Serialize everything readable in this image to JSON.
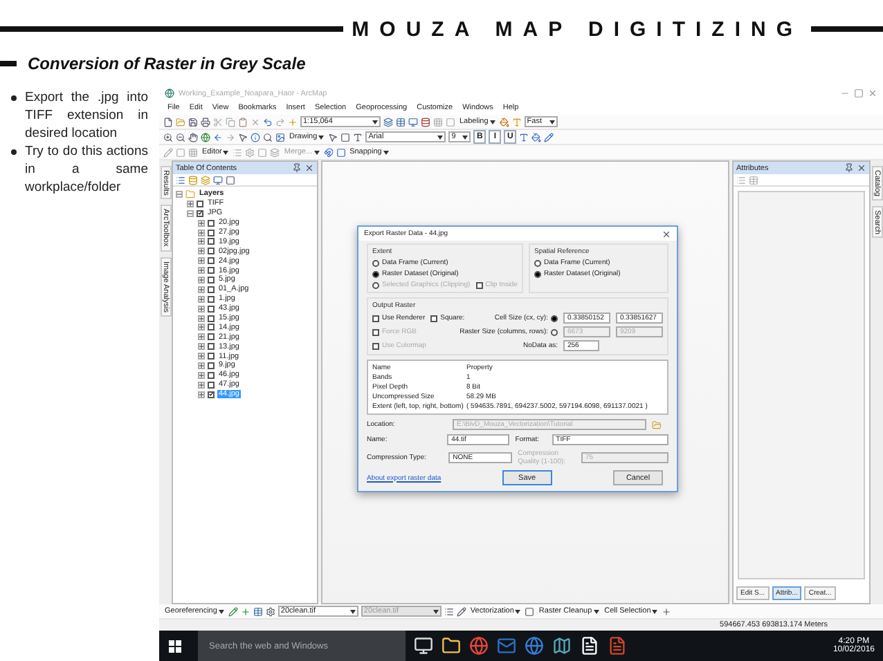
{
  "slide": {
    "title": "MOUZA MAP DIGITIZING",
    "subtitle": "Conversion of Raster in Grey Scale",
    "bullets": [
      "Export the .jpg into TIFF extension in desired location",
      "Try to do this actions in a same workplace/folder"
    ]
  },
  "app": {
    "title": "Working_Example_Noapara_Haor - ArcMap",
    "menu": [
      "File",
      "Edit",
      "View",
      "Bookmarks",
      "Insert",
      "Selection",
      "Geoprocessing",
      "Customize",
      "Windows",
      "Help"
    ],
    "toolbars": [
      {
        "items": [
          {
            "kind": "field",
            "value": "1:15,064",
            "disabled": false
          },
          {
            "kind": "menu",
            "label": "Labeling",
            "disabled": false
          },
          {
            "kind": "field",
            "value": "Fast",
            "disabled": false
          }
        ]
      },
      {
        "items": [
          {
            "kind": "menu",
            "label": "Drawing",
            "disabled": false
          },
          {
            "kind": "field",
            "value": "Arial",
            "disabled": false
          },
          {
            "kind": "field",
            "value": "9",
            "disabled": false
          },
          {
            "kind": "text_button",
            "label": "B"
          },
          {
            "kind": "text_button",
            "label": "I"
          },
          {
            "kind": "text_button",
            "label": "U"
          }
        ]
      },
      {
        "items": [
          {
            "kind": "menu",
            "label": "Editor",
            "disabled": false
          },
          {
            "kind": "menu",
            "label": "Merge...",
            "disabled": true
          },
          {
            "kind": "menu",
            "label": "Snapping",
            "disabled": false
          }
        ]
      }
    ],
    "left_tabs": [
      "Results",
      "ArcToolbox",
      "Image Analysis"
    ],
    "right_tabs": [
      "Catalog",
      "Search"
    ],
    "toc": {
      "title": "Table Of Contents",
      "tree": [
        {
          "kind": "frame",
          "label": "Layers",
          "expanded": true,
          "selected": false,
          "children": [
            {
              "kind": "layer",
              "label": "TIFF",
              "expanded": false,
              "checked": false,
              "selected": false
            },
            {
              "kind": "layer",
              "label": "JPG",
              "expanded": true,
              "checked": true,
              "selected": false,
              "children": [
                {
                  "kind": "layer",
                  "label": "20.jpg",
                  "expanded": false,
                  "checked": false,
                  "selected": false
                },
                {
                  "kind": "layer",
                  "label": "27.jpg",
                  "expanded": false,
                  "checked": false,
                  "selected": false
                },
                {
                  "kind": "layer",
                  "label": "19.jpg",
                  "expanded": false,
                  "checked": false,
                  "selected": false
                },
                {
                  "kind": "layer",
                  "label": "02jpg.jpg",
                  "expanded": false,
                  "checked": false,
                  "selected": false
                },
                {
                  "kind": "layer",
                  "label": "24.jpg",
                  "expanded": false,
                  "checked": false,
                  "selected": false
                },
                {
                  "kind": "layer",
                  "label": "16.jpg",
                  "expanded": false,
                  "checked": false,
                  "selected": false
                },
                {
                  "kind": "layer",
                  "label": "5.jpg",
                  "expanded": false,
                  "checked": false,
                  "selected": false
                },
                {
                  "kind": "layer",
                  "label": "01_A.jpg",
                  "expanded": false,
                  "checked": false,
                  "selected": false
                },
                {
                  "kind": "layer",
                  "label": "1.jpg",
                  "expanded": false,
                  "checked": false,
                  "selected": false
                },
                {
                  "kind": "layer",
                  "label": "43.jpg",
                  "expanded": false,
                  "checked": false,
                  "selected": false
                },
                {
                  "kind": "layer",
                  "label": "15.jpg",
                  "expanded": false,
                  "checked": false,
                  "selected": false
                },
                {
                  "kind": "layer",
                  "label": "14.jpg",
                  "expanded": false,
                  "checked": false,
                  "selected": false
                },
                {
                  "kind": "layer",
                  "label": "21.jpg",
                  "expanded": false,
                  "checked": false,
                  "selected": false
                },
                {
                  "kind": "layer",
                  "label": "13.jpg",
                  "expanded": false,
                  "checked": false,
                  "selected": false
                },
                {
                  "kind": "layer",
                  "label": "11.jpg",
                  "expanded": false,
                  "checked": false,
                  "selected": false
                },
                {
                  "kind": "layer",
                  "label": "9.jpg",
                  "expanded": false,
                  "checked": false,
                  "selected": false
                },
                {
                  "kind": "layer",
                  "label": "46.jpg",
                  "expanded": false,
                  "checked": false,
                  "selected": false
                },
                {
                  "kind": "layer",
                  "label": "47.jpg",
                  "expanded": false,
                  "checked": false,
                  "selected": false
                },
                {
                  "kind": "layer",
                  "label": "44.jpg",
                  "expanded": false,
                  "checked": true,
                  "selected": true
                }
              ]
            }
          ]
        }
      ]
    },
    "attributes": {
      "title": "Attributes",
      "tabs": [
        {
          "label": "Edit S...",
          "selected": false
        },
        {
          "label": "Attrib...",
          "selected": true
        },
        {
          "label": "Creat...",
          "selected": false
        }
      ]
    },
    "bottom_toolbar": {
      "items": [
        {
          "kind": "menu",
          "label": "Georeferencing",
          "disabled": false
        },
        {
          "kind": "field",
          "value": "20clean.tif",
          "disabled": false
        },
        {
          "kind": "field",
          "value": "20clean.tif",
          "disabled": true
        },
        {
          "kind": "menu",
          "label": "Vectorization",
          "disabled": false
        },
        {
          "kind": "menu",
          "label": "Raster Cleanup",
          "disabled": false
        },
        {
          "kind": "menu",
          "label": "Cell Selection",
          "disabled": false
        }
      ]
    },
    "status": "594667.453  693813.174 Meters"
  },
  "dialog": {
    "title": "Export Raster Data - 44.jpg",
    "extent": {
      "label": "Extent",
      "options": [
        {
          "label": "Data Frame (Current)",
          "selected": false,
          "disabled": false
        },
        {
          "label": "Raster Dataset (Original)",
          "selected": true,
          "disabled": false
        },
        {
          "label": "Selected Graphics (Clipping)",
          "selected": false,
          "disabled": true
        }
      ],
      "clip_inside": {
        "label": "Clip Inside",
        "checked": false,
        "disabled": true
      }
    },
    "spatial_reference": {
      "label": "Spatial Reference",
      "options": [
        {
          "label": "Data Frame (Current)",
          "selected": false,
          "disabled": false
        },
        {
          "label": "Raster Dataset (Original)",
          "selected": true,
          "disabled": false
        }
      ]
    },
    "output_raster": {
      "label": "Output Raster",
      "use_renderer": {
        "label": "Use Renderer",
        "checked": false,
        "disabled": false
      },
      "square": {
        "label": "Square:",
        "checked": false,
        "disabled": false
      },
      "force_rgb": {
        "label": "Force RGB",
        "checked": false,
        "disabled": true
      },
      "use_colormap": {
        "label": "Use Colormap",
        "checked": false,
        "disabled": true
      },
      "cell_size": {
        "label": "Cell Size (cx, cy):",
        "selected": true,
        "values": [
          "0.33850152",
          "0.33851627"
        ]
      },
      "raster_size": {
        "label": "Raster Size (columns, rows):",
        "selected": false,
        "values": [
          "6673",
          "9209"
        ]
      },
      "nodata": {
        "label": "NoData as:",
        "value": "256"
      }
    },
    "properties": {
      "columns": [
        "Name",
        "Property"
      ],
      "rows": [
        [
          "Bands",
          "1"
        ],
        [
          "Pixel Depth",
          "8 Bit"
        ],
        [
          "Uncompressed Size",
          "58.29 MB"
        ],
        [
          "Extent (left, top, right, bottom)",
          "( 594635.7891, 694237.5002, 597194.6098, 691137.0021 )"
        ]
      ]
    },
    "location": {
      "label": "Location:",
      "value": "E:\\BivD_Mouza_Vectorization\\Tutorial"
    },
    "name": {
      "label": "Name:",
      "value": "44.tif"
    },
    "format": {
      "label": "Format:",
      "value": "TIFF"
    },
    "compression_type": {
      "label": "Compression Type:",
      "value": "NONE"
    },
    "compression_quality": {
      "label": "Compression Quality (1-100):",
      "value": "75",
      "disabled": true
    },
    "help_link": "About export raster data",
    "buttons": [
      {
        "label": "Save",
        "default": true
      },
      {
        "label": "Cancel",
        "default": false
      }
    ]
  },
  "taskbar": {
    "search_placeholder": "Search the web and Windows",
    "time": "4:20 PM",
    "date": "10/02/2016"
  }
}
